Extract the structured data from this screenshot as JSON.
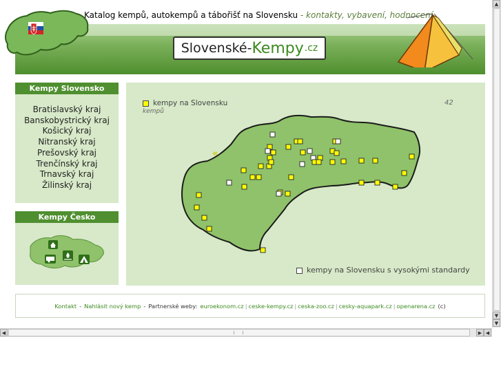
{
  "header": {
    "tagline_main": "Katalog kempů, autokempů a tábořišť na Slovensku",
    "tagline_sep": " - ",
    "tagline_sub": "kontakty, vybavení, hodnocení",
    "logo_left": "Slovenské-",
    "logo_mid": "Kempy",
    "logo_right": ".cz"
  },
  "sidebar": {
    "sk_title": "Kempy Slovensko",
    "regions": [
      "Bratislavský kraj",
      "Banskobystrický kraj",
      "Košický kraj",
      "Nitranský kraj",
      "Prešovský kraj",
      "Trenčínský kraj",
      "Trnavský kraj",
      "Žilinský kraj"
    ],
    "cz_title": "Kempy Česko"
  },
  "map": {
    "legend_camps": "kempy na Slovensku",
    "camp_count": "42",
    "camp_unit": "kempů",
    "legend_high": "kempy na Slovensku s vysokými standardy",
    "arrow_glyph": "«",
    "colors": {
      "camp": "#ffff00",
      "high_standard": "#ffffff",
      "map_fill": "#8fc26a"
    }
  },
  "footer": {
    "contact": "Kontakt",
    "add_camp": "Nahlásit nový kemp",
    "partners_label": "Partnerské weby:",
    "partners": [
      "euroekonom.cz",
      "ceske-kempy.cz",
      "ceska-zoo.cz",
      "cesky-aquapark.cz",
      "openarena.cz"
    ],
    "copyright": "(c)"
  },
  "scrollbar": {
    "up": "▲",
    "down": "▼",
    "left": "◀",
    "right": "▶"
  }
}
